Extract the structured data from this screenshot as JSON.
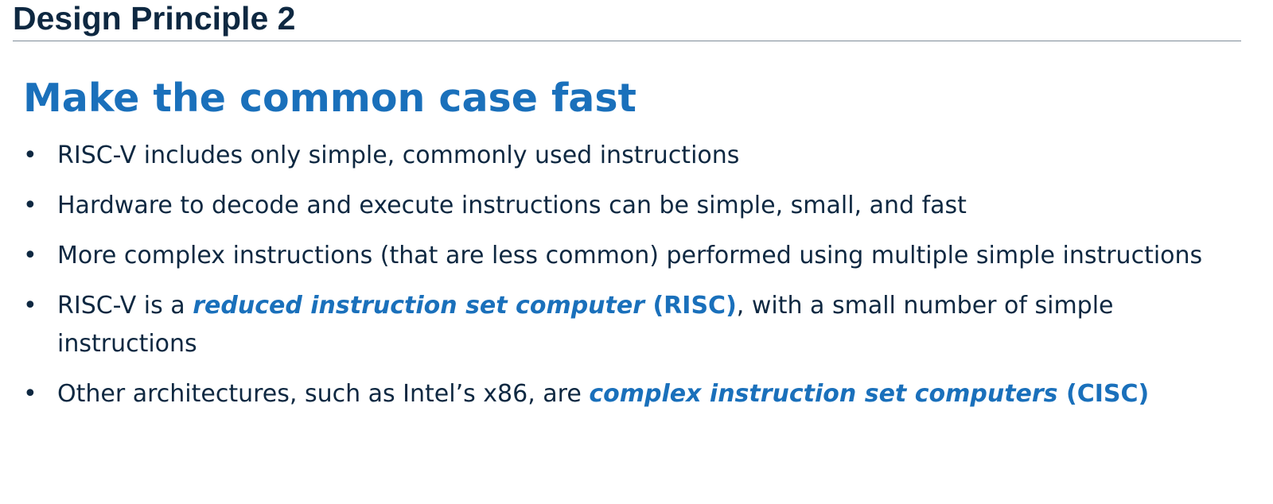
{
  "slide": {
    "title": "Design Principle 2",
    "heading": "Make the common case fast",
    "bullet_marker": "•",
    "bullets": [
      {
        "text": "RISC-V includes only simple, commonly used instructions"
      },
      {
        "text": "Hardware to decode and execute instructions can be simple, small, and fast"
      },
      {
        "text": "More complex instructions (that are less common) performed using multiple simple instructions"
      },
      {
        "prefix": "RISC-V is a ",
        "emphasis": "reduced instruction set computer",
        "abbr": " (RISC)",
        "suffix": ", with a small number of simple instructions"
      },
      {
        "prefix": "Other architectures, such as Intel’s x86, are ",
        "emphasis": "complex instruction set computers",
        "abbr": " (CISC)",
        "suffix": ""
      }
    ]
  },
  "colors": {
    "title": "#0e2841",
    "accent": "#1a70bb",
    "body_text": "#0e2841",
    "rule": "#7f8c99"
  }
}
